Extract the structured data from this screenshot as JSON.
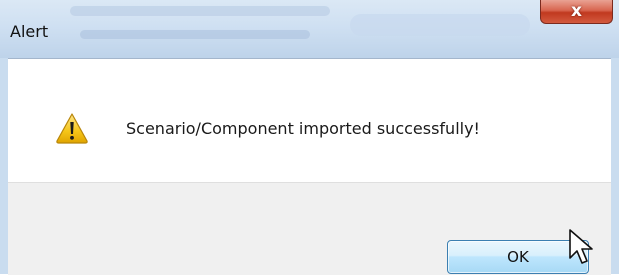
{
  "window": {
    "title": "Alert",
    "close_glyph": "x",
    "close_icon": "close-icon"
  },
  "message": {
    "icon": "warning-icon",
    "text": "Scenario/Component imported successfully!"
  },
  "buttons": {
    "ok_label": "OK"
  },
  "colors": {
    "titlebar": "#cfe0f2",
    "close_button": "#c1391f",
    "footer": "#f0f0f0",
    "ok_button_border": "#3c7fb1",
    "warning_fill": "#f5c518"
  }
}
